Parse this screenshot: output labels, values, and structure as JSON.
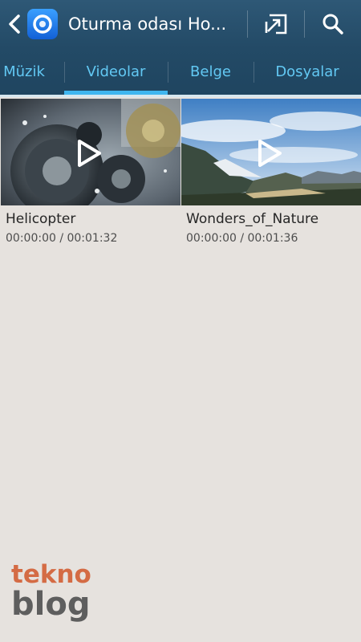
{
  "header": {
    "title": "Oturma odası Ho...",
    "back_icon": "chevron-left-icon",
    "app_icon": "samsung-link-icon",
    "actions": [
      {
        "name": "screen-mirror-icon"
      },
      {
        "name": "search-icon"
      }
    ]
  },
  "tabs": [
    {
      "label": "Müzik",
      "selected": false
    },
    {
      "label": "Videolar",
      "selected": true
    },
    {
      "label": "Belge",
      "selected": false
    },
    {
      "label": "Dosyalar",
      "selected": false
    }
  ],
  "colors": {
    "action_bar": "#2e5876",
    "tab_text": "#62c8f3",
    "tab_indicator": "#3fb6ef",
    "background": "#e6e2de",
    "watermark_tekno": "#d46b44",
    "watermark_blog": "#5e5e5e"
  },
  "videos": [
    {
      "title": "Helicopter",
      "time": "00:00:00 / 00:01:32",
      "play_icon": "play-icon"
    },
    {
      "title": "Wonders_of_Nature",
      "time": "00:00:00 / 00:01:36",
      "play_icon": "play-icon"
    }
  ],
  "watermark": {
    "line1": "tekno",
    "line2": "blog"
  }
}
